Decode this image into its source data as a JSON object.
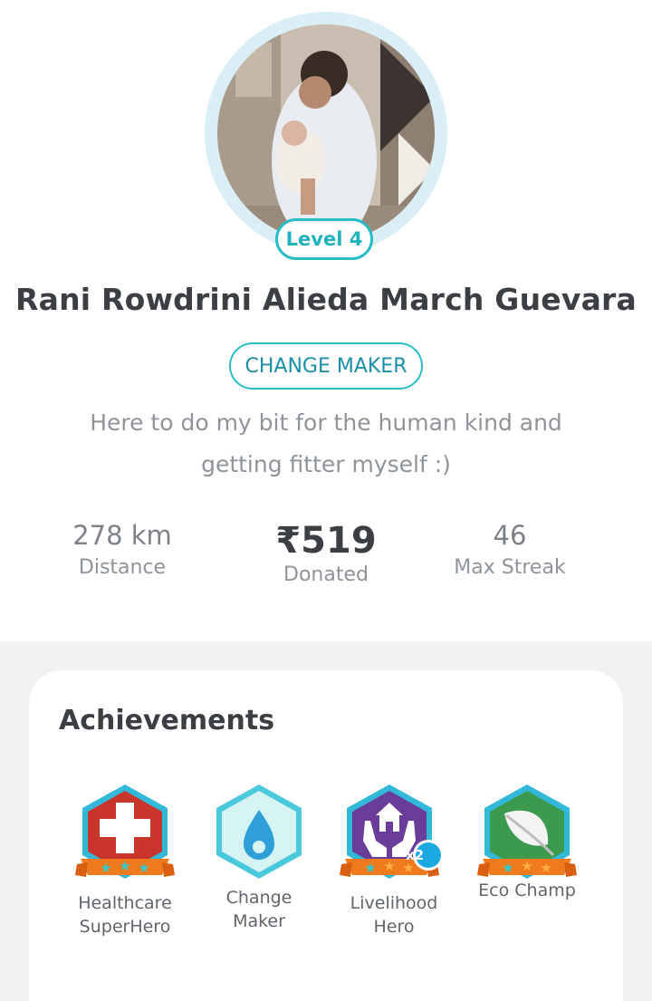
{
  "profile": {
    "level_label": "Level 4",
    "name": "Rani Rowdrini Alieda March Guevara",
    "tag": "CHANGE MAKER",
    "bio_line1": "Here to do my bit for the human kind and",
    "bio_line2": "getting fitter myself :)"
  },
  "stats": [
    {
      "value": "278 km",
      "label": "Distance"
    },
    {
      "value": "₹519",
      "label": "Donated"
    },
    {
      "value": "46",
      "label": "Max Streak"
    }
  ],
  "achievements": {
    "title": "Achievements",
    "badges": [
      {
        "icon": "healthcare-cross-icon",
        "line1": "Healthcare",
        "line2": "SuperHero",
        "count": ""
      },
      {
        "icon": "flame-drop-icon",
        "line1": "Change",
        "line2": "Maker",
        "count": ""
      },
      {
        "icon": "house-hands-icon",
        "line1": "Livelihood",
        "line2": "Hero",
        "count": "x2"
      },
      {
        "icon": "leaf-icon",
        "line1": "Eco Champ",
        "line2": "",
        "count": ""
      }
    ]
  },
  "colors": {
    "accent": "#27bcc6",
    "tag_text": "#1c8fa8",
    "background_gray": "#f0f1f3"
  }
}
